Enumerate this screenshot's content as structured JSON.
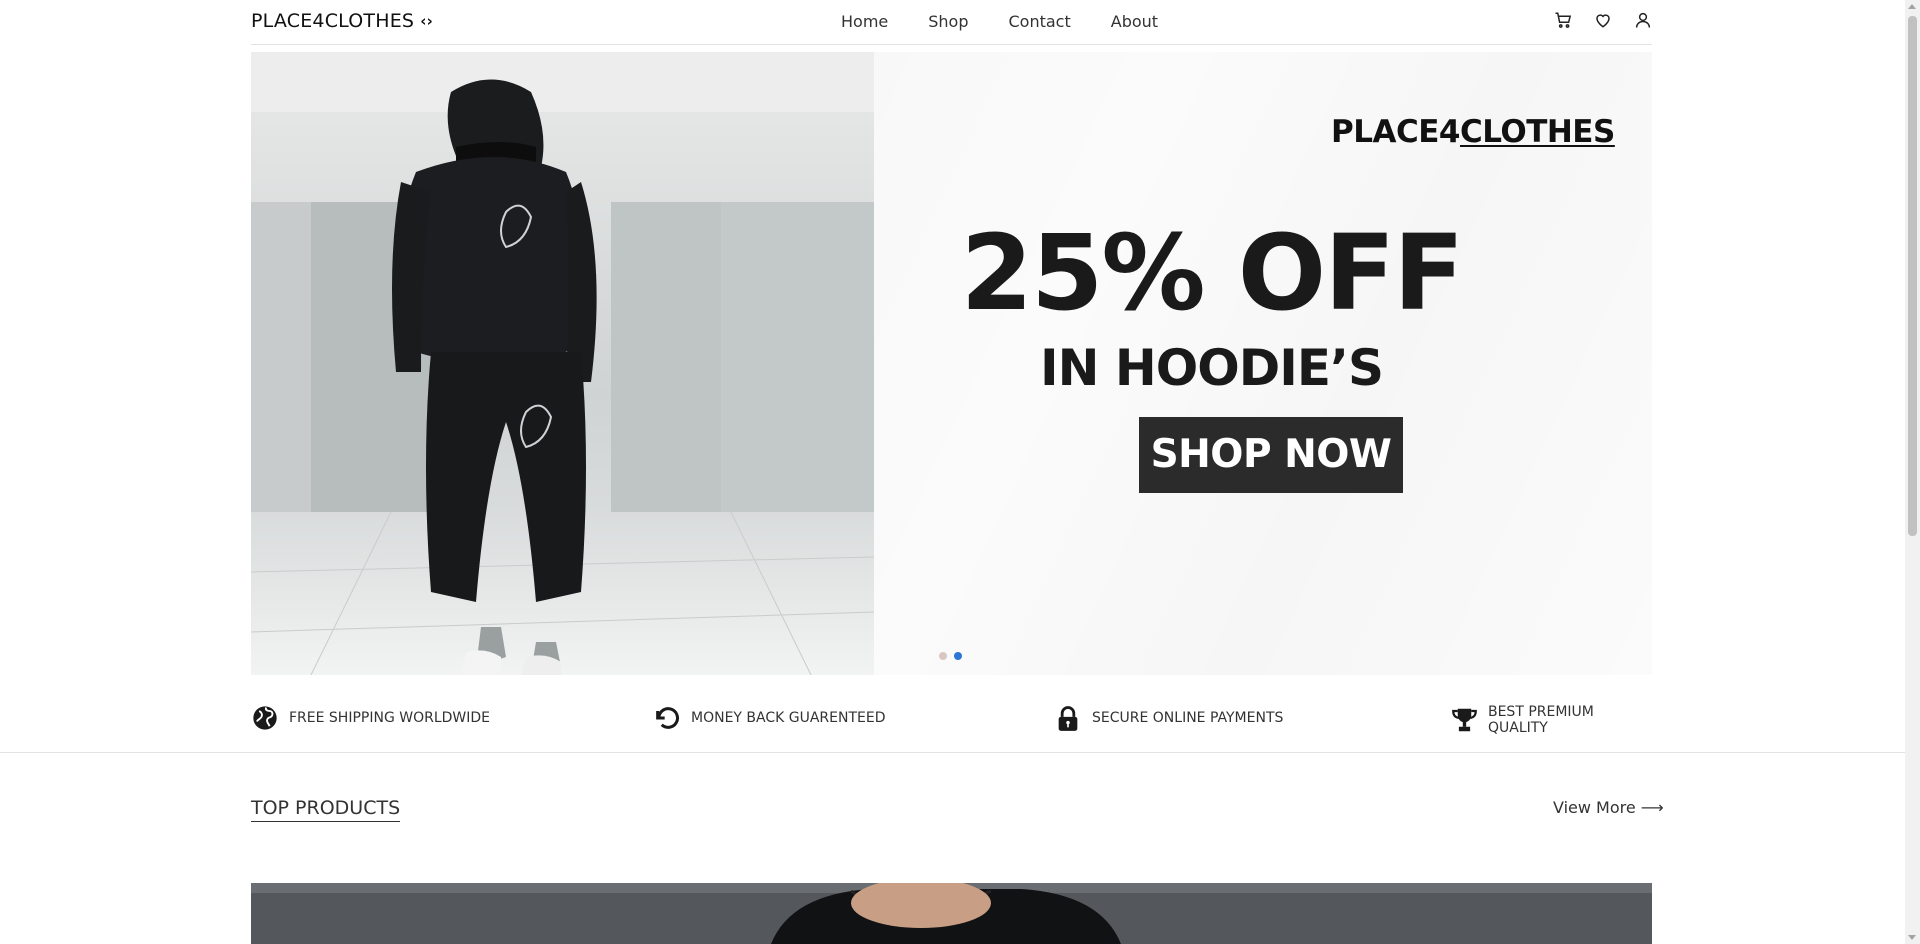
{
  "header": {
    "logo_text": "PLACE4CLOTHES",
    "logo_icon": "‹›",
    "nav": [
      "Home",
      "Shop",
      "Contact",
      "About"
    ],
    "icons": [
      "cart-icon",
      "heart-icon",
      "user-icon"
    ]
  },
  "hero": {
    "brand_prefix": "PLACE4",
    "brand_suffix": "CLOTHES",
    "headline": "25% OFF",
    "subheadline": "IN HOODIE’S",
    "cta_label": "SHOP NOW",
    "slides": 2,
    "active_slide": 2
  },
  "features": [
    {
      "icon": "globe-icon",
      "label": "FREE SHIPPING WORLDWIDE"
    },
    {
      "icon": "refresh-icon",
      "label": "MONEY BACK GUARENTEED"
    },
    {
      "icon": "lock-icon",
      "label": "SECURE ONLINE PAYMENTS"
    },
    {
      "icon": "trophy-icon",
      "label": "BEST PREMIUM QUALITY"
    }
  ],
  "top_products": {
    "title": "TOP PRODUCTS",
    "view_more_label": "View More ⟶"
  },
  "colors": {
    "accent": "#2a77d4",
    "button": "#2b2b2b",
    "text": "#222222"
  }
}
